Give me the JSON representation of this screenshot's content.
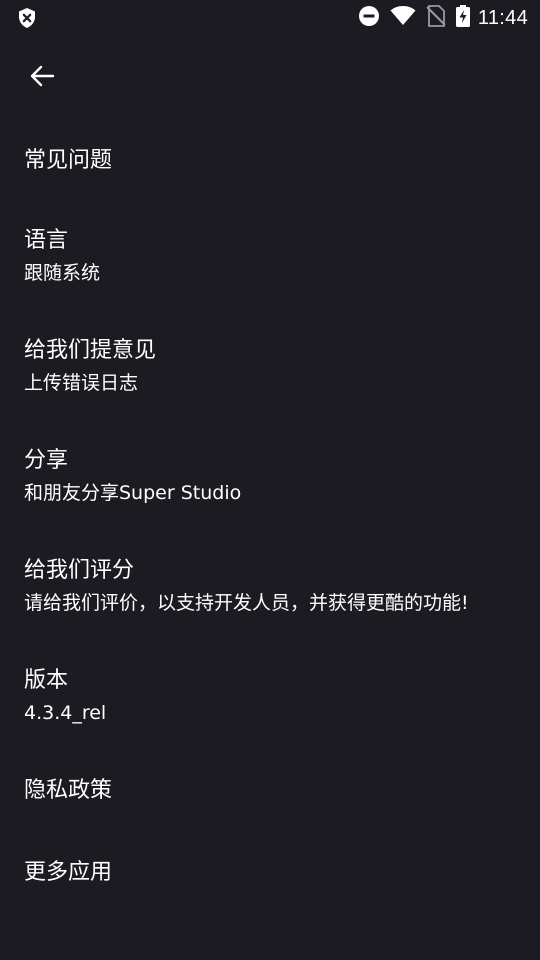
{
  "status_bar": {
    "time": "11:44",
    "icons": [
      "shield-x-icon",
      "do-not-disturb-icon",
      "wifi-icon",
      "no-sim-icon",
      "battery-charging-icon"
    ]
  },
  "toolbar": {
    "back_icon": "arrow-left-icon"
  },
  "items": [
    {
      "title": "常见问题"
    },
    {
      "title": "语言",
      "subtitle": "跟随系统"
    },
    {
      "title": "给我们提意见",
      "subtitle": "上传错误日志"
    },
    {
      "title": "分享",
      "subtitle": "和朋友分享Super Studio"
    },
    {
      "title": "给我们评分",
      "subtitle": "请给我们评价，以支持开发人员，并获得更酷的功能!"
    },
    {
      "title": "版本",
      "subtitle": "4.3.4_rel"
    },
    {
      "title": "隐私政策"
    },
    {
      "title": "更多应用"
    }
  ],
  "colors": {
    "background": "#1c1b22",
    "text": "#ffffff"
  }
}
